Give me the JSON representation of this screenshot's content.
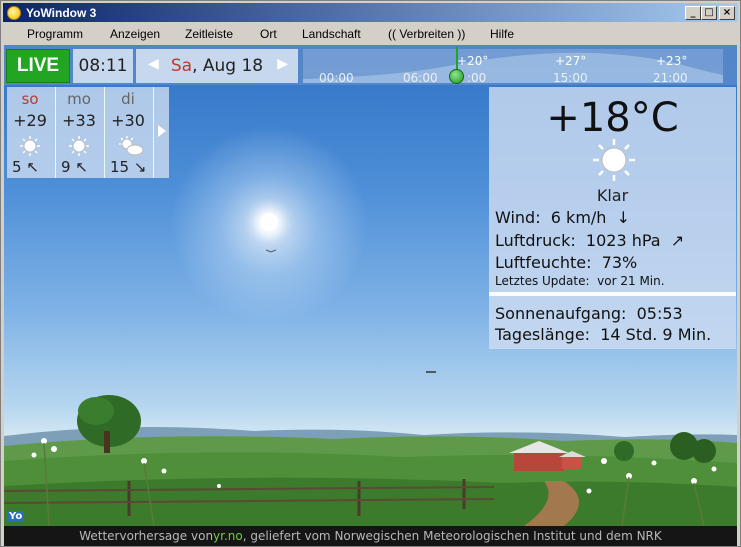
{
  "window": {
    "title": "YoWindow 3"
  },
  "menu": [
    "Programm",
    "Anzeigen",
    "Zeitleiste",
    "Ort",
    "Landschaft",
    "(( Verbreiten ))",
    "Hilfe"
  ],
  "timebar": {
    "live_label": "LIVE",
    "time": "08:11",
    "weekday": "Sa",
    "date_rest": ", Aug 18",
    "ticks": [
      "00:00",
      "06:00",
      ":00",
      "15:00",
      "21:00"
    ],
    "temps": [
      "+20°",
      "+27°",
      "+23°"
    ]
  },
  "forecast": [
    {
      "day": "so",
      "temp": "+29",
      "icon": "sun-icon",
      "wind": "5",
      "wind_dir": "↖"
    },
    {
      "day": "mo",
      "temp": "+33",
      "icon": "sun-icon",
      "wind": "9",
      "wind_dir": "↖"
    },
    {
      "day": "di",
      "temp": "+30",
      "icon": "partly-cloudy-icon",
      "wind": "15",
      "wind_dir": "↘"
    }
  ],
  "current": {
    "temperature": "+18°C",
    "condition": "Klar",
    "wind_label": "Wind:",
    "wind_value": "6 km/h",
    "wind_dir": "↓",
    "pressure_label": "Luftdruck:",
    "pressure_value": "1023 hPa",
    "pressure_trend": "↗",
    "humidity_label": "Luftfeuchte:",
    "humidity_value": "73%",
    "update_label": "Letztes Update:",
    "update_value": "vor 21 Min.",
    "sunrise_label": "Sonnenaufgang:",
    "sunrise_value": "05:53",
    "daylength_label": "Tageslänge:",
    "daylength_value": "14 Std. 9 Min."
  },
  "footer": {
    "prefix": "Wettervorhersage von ",
    "source": "yr.no",
    "suffix": ", geliefert vom Norwegischen Meteorologischen Institut und dem NRK"
  },
  "colors": {
    "live": "#22a522",
    "weekday_red": "#c0392b",
    "source_link": "#6fcf3f"
  }
}
